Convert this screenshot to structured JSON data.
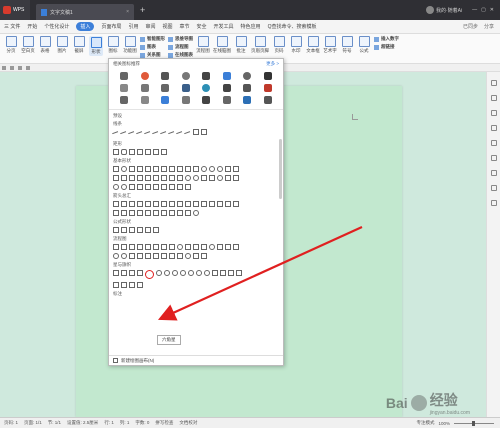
{
  "titlebar": {
    "app_label": "WPS",
    "doc_tab": "文字文稿1",
    "close_glyph": "×",
    "new_tab_glyph": "+",
    "user_label": "我的·随着Ai"
  },
  "menubar": {
    "file": "三 文件",
    "items": [
      "开始",
      "个性化设计",
      "插入",
      "页面布局",
      "引用",
      "审阅",
      "视图",
      "章节",
      "安全",
      "开发工具",
      "特色应用"
    ],
    "active_index": 2,
    "search": "Q查找命令、搜索模板",
    "right": [
      "已同步",
      "分享"
    ]
  },
  "ribbon": {
    "buttons": [
      "分页",
      "空白页",
      "表格",
      "图片",
      "截屏",
      "形状",
      "图标",
      "功能图"
    ],
    "group1": [
      "智能图形",
      "图表",
      "关系图"
    ],
    "group2": [
      "思维导图",
      "流程图",
      "在线图表"
    ],
    "buttons2": [
      "流程图",
      "在线脑图",
      "批注",
      "页眉页脚",
      "页码",
      "水印"
    ],
    "buttons3": [
      "文本框",
      "艺术字",
      "符号",
      "公式"
    ],
    "group3": [
      "插入数字",
      "超链接"
    ]
  },
  "shapes_panel": {
    "header": "相关图标推荐",
    "more": "更多 >",
    "sections": [
      "预设",
      "线条",
      "矩形",
      "基本形状",
      "箭头总汇",
      "公式形状",
      "流程图",
      "星与旗帜",
      "标注"
    ],
    "tooltip": "六角星",
    "footer": "新建绘图画布(N)"
  },
  "statusbar": {
    "items": [
      "页码: 1",
      "页面: 1/1",
      "节: 1/1",
      "设置值: 2.5厘米",
      "行: 1",
      "列: 1",
      "字数: 0",
      "拼写检查",
      "文档校对",
      "专注模式"
    ],
    "zoom": "100%"
  },
  "watermark": {
    "brand": "Bai",
    "suffix": "经验",
    "url": "jingyan.baidu.com"
  }
}
